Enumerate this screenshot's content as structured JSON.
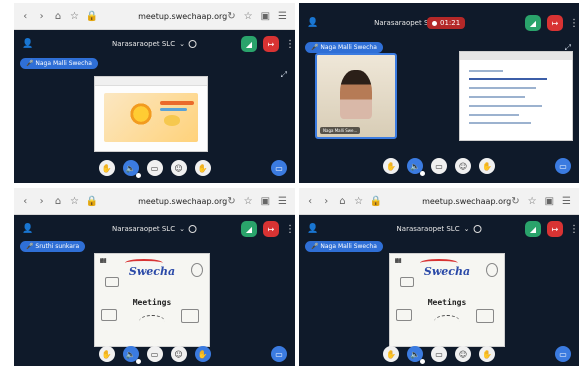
{
  "panels": [
    {
      "browser": {
        "url": "meetup.swechaap.org"
      },
      "room": "Narasaraopet SLC",
      "speaker": "Naga Malli Swecha"
    },
    {
      "room": "Narasaraopet SLC",
      "recording_time": "01:21",
      "speaker": "Naga Malli Swecha",
      "video_label": "Naga Malli Swe..."
    },
    {
      "browser": {
        "url": "meetup.swechaap.org"
      },
      "room": "Narasaraopet SLC",
      "speaker": "Sruthi sunkara",
      "slide": {
        "logo": "Swecha",
        "title": "Meetings"
      }
    },
    {
      "browser": {
        "url": "meetup.swechaap.org"
      },
      "room": "Narasaraopet SLC",
      "speaker": "Naga Malli Swecha",
      "slide": {
        "logo": "Swecha",
        "title": "Meetings"
      }
    }
  ],
  "colors": {
    "bg": "#0f1a2a",
    "accent_blue": "#3b7be0",
    "green": "#2aa36b",
    "red": "#d83333"
  },
  "icons": [
    "back-icon",
    "forward-icon",
    "home-icon",
    "star-icon",
    "lock-icon",
    "reload-icon",
    "bookmark-icon",
    "tabs-icon",
    "menu-icon",
    "people-icon",
    "stats-icon",
    "leave-icon",
    "kebab-icon",
    "hand-icon",
    "speaker-icon",
    "camera-icon",
    "emoji-icon",
    "raise-hand-icon",
    "screen-share-icon",
    "expand-icon"
  ]
}
